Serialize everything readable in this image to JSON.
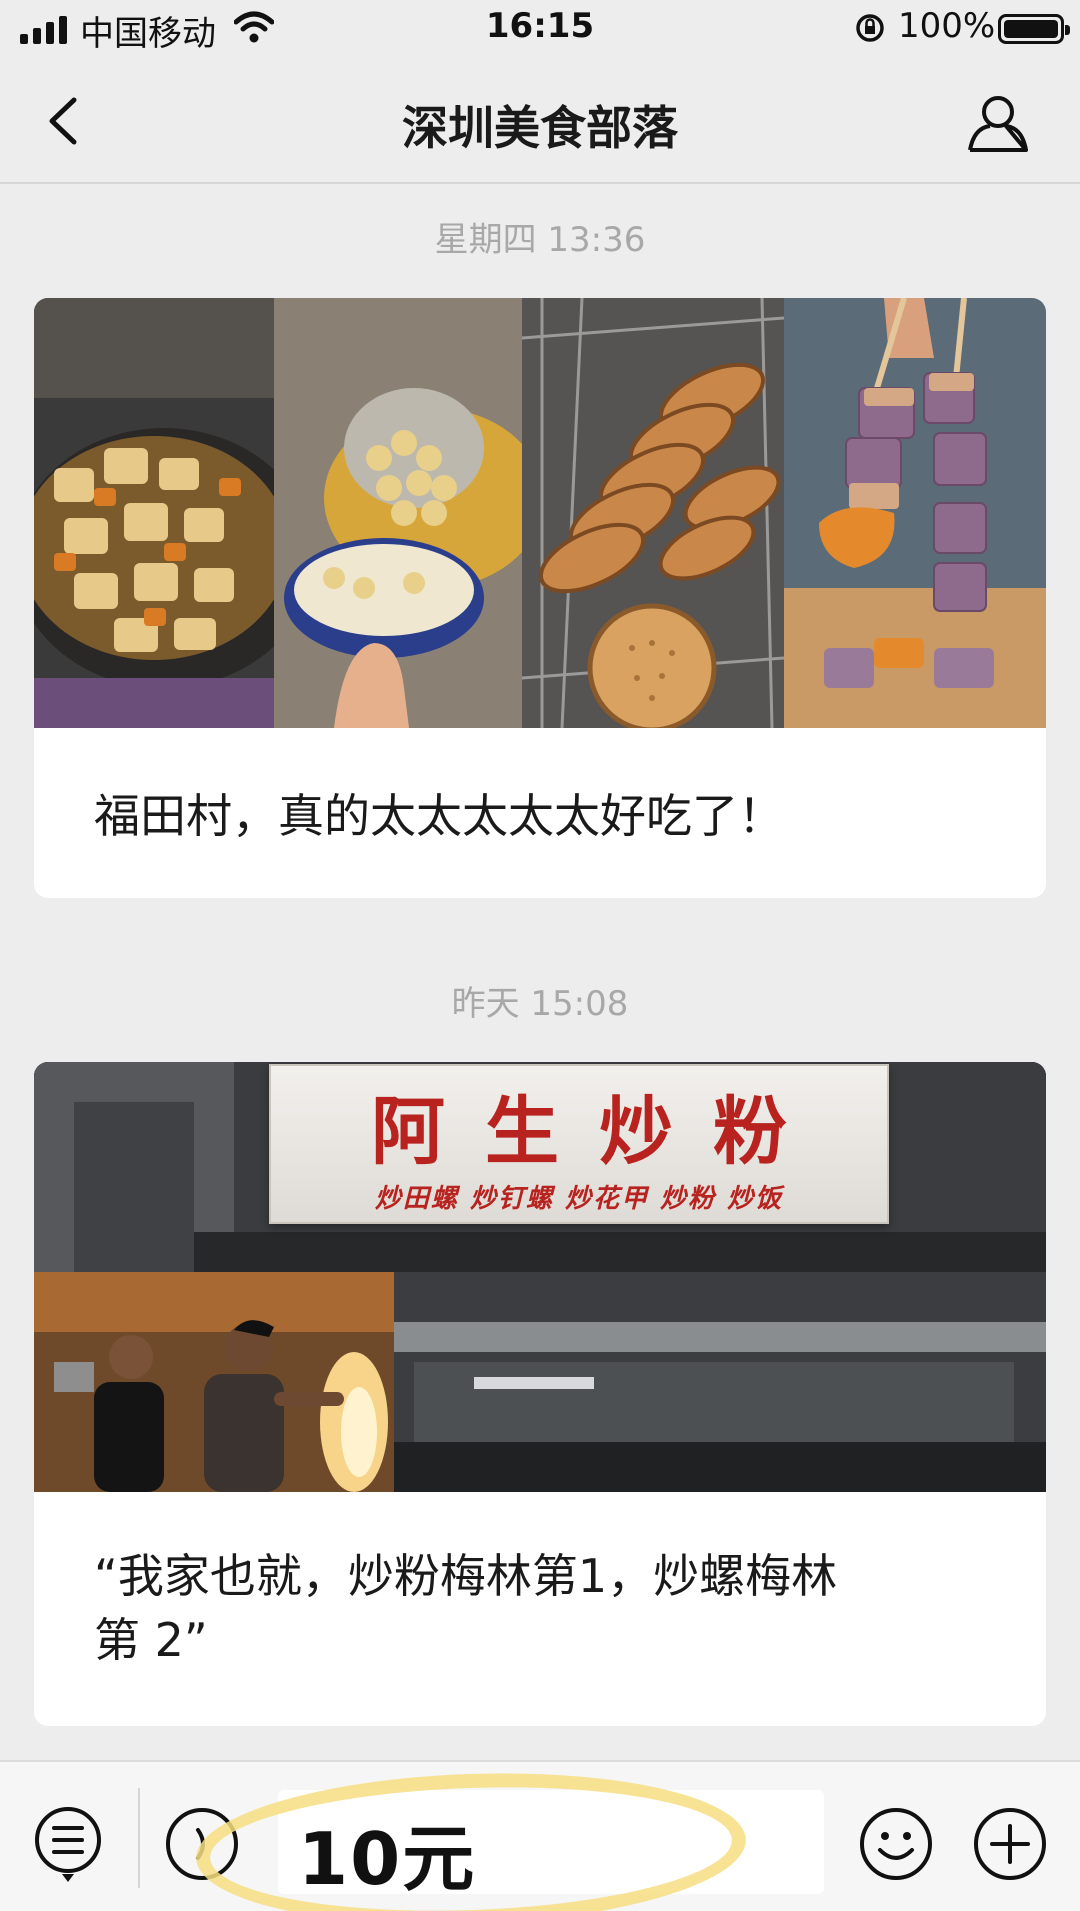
{
  "status_bar": {
    "carrier": "中国移动",
    "time": "16:15",
    "battery": "100%"
  },
  "nav": {
    "title": "深圳美食部落"
  },
  "messages": [
    {
      "timestamp": "星期四 13:36",
      "text": "福田村，真的太太太太太好吃了！"
    },
    {
      "timestamp": "昨天 15:08",
      "text_line1": "“我家也就，炒粉梅林第1，炒螺梅林",
      "text_line2": "第 2”",
      "sign_title": "阿生炒粉",
      "sign_subtitle": "炒田螺 炒钉螺 炒花甲 炒粉 炒饭"
    }
  ],
  "input": {
    "value": "10元"
  },
  "icons": {
    "back": "chevron-left-icon",
    "profile": "person-icon",
    "menu": "list-menu-icon",
    "voice": "voice-icon",
    "emoji": "smiley-icon",
    "plus": "plus-icon"
  },
  "colors": {
    "background": "#ededed",
    "card": "#ffffff",
    "timestamp": "#a8a8a8",
    "sign_red": "#b8231f",
    "highlight": "#f7de82"
  }
}
